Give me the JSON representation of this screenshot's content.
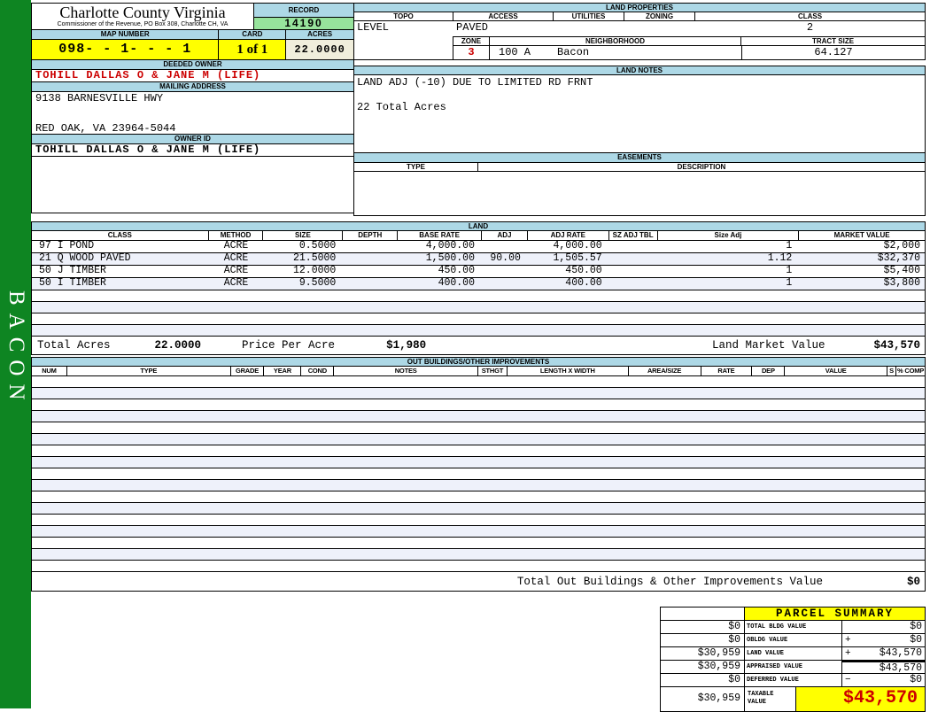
{
  "colors": {
    "band_green": "#0e8522",
    "bar_blue": "#ADD8E6",
    "highlight_yellow": "#ffff00",
    "record_green": "#97e39c",
    "acres_cream": "#f0eedc",
    "alert_red": "#cc0000",
    "alt_row": "#eef1fa"
  },
  "sidebar": {
    "band_text": "BACON"
  },
  "header": {
    "county_title": "Charlotte County Virginia",
    "county_subtitle": "Commissioner of the Revenue, PO Box 308, Charlotte CH, VA",
    "record_label": "RECORD",
    "record_value": "14190",
    "map_number_label": "MAP NUMBER",
    "map_number_value": "098- - 1- - - 1",
    "card_label": "CARD",
    "card_value": "1 of 1",
    "acres_label": "ACRES",
    "acres_value": "22.0000"
  },
  "owner": {
    "deeded_owner_label": "DEEDED OWNER",
    "deeded_owner": "TOHILL DALLAS O & JANE M (LIFE)",
    "mailing_address_label": "MAILING ADDRESS",
    "address_line1": "9138 BARNESVILLE HWY",
    "address_line2": "RED OAK, VA 23964-5044",
    "owner_id_label": "OWNER ID",
    "owner_id": "TOHILL DALLAS O & JANE M (LIFE)"
  },
  "land_properties": {
    "section_label": "LAND PROPERTIES",
    "topo_label": "TOPO",
    "topo": "LEVEL",
    "access_label": "ACCESS",
    "access": "PAVED",
    "utilities_label": "UTILITIES",
    "utilities": "",
    "zoning_label": "ZONING",
    "zoning": "",
    "class_label": "CLASS",
    "class": "2",
    "zone_label": "ZONE",
    "zone": "3",
    "neighborhood_label": "NEIGHBORHOOD",
    "neighborhood_code": "100 A",
    "neighborhood_name": "Bacon",
    "tract_size_label": "TRACT SIZE",
    "tract_size": "64.127"
  },
  "land_notes": {
    "section_label": "LAND NOTES",
    "line1": "LAND ADJ (-10) DUE TO LIMITED RD FRNT",
    "line2": "22 Total Acres"
  },
  "easements": {
    "section_label": "EASEMENTS",
    "type_label": "TYPE",
    "description_label": "DESCRIPTION"
  },
  "land_table": {
    "section_label": "LAND",
    "headers": [
      "CLASS",
      "METHOD",
      "SIZE",
      "DEPTH",
      "BASE RATE",
      "ADJ",
      "ADJ RATE",
      "SZ ADJ TBL",
      "Size Adj",
      "MARKET VALUE"
    ],
    "rows": [
      {
        "class": "97 I POND",
        "method": "ACRE",
        "size": "0.5000",
        "depth": "",
        "base_rate": "4,000.00",
        "adj": "",
        "adj_rate": "4,000.00",
        "sz_adj_tbl": "",
        "size_adj": "1",
        "market_value": "$2,000"
      },
      {
        "class": "21 Q WOOD PAVED",
        "method": "ACRE",
        "size": "21.5000",
        "depth": "",
        "base_rate": "1,500.00",
        "adj": "90.00",
        "adj_rate": "1,505.57",
        "sz_adj_tbl": "",
        "size_adj": "1.12",
        "market_value": "$32,370"
      },
      {
        "class": "50 J TIMBER",
        "method": "ACRE",
        "size": "12.0000",
        "depth": "",
        "base_rate": "450.00",
        "adj": "",
        "adj_rate": "450.00",
        "sz_adj_tbl": "",
        "size_adj": "1",
        "market_value": "$5,400"
      },
      {
        "class": "50 I TIMBER",
        "method": "ACRE",
        "size": "9.5000",
        "depth": "",
        "base_rate": "400.00",
        "adj": "",
        "adj_rate": "400.00",
        "sz_adj_tbl": "",
        "size_adj": "1",
        "market_value": "$3,800"
      }
    ],
    "total_acres_label": "Total Acres",
    "total_acres": "22.0000",
    "price_per_acre_label": "Price Per Acre",
    "price_per_acre": "$1,980",
    "land_market_value_label": "Land Market Value",
    "land_market_value": "$43,570"
  },
  "out_buildings": {
    "section_label": "OUT BUILDINGS/OTHER IMPROVEMENTS",
    "headers": [
      "NUM",
      "TYPE",
      "GRADE",
      "YEAR",
      "COND",
      "NOTES",
      "STHGT",
      "LENGTH X WIDTH",
      "AREA/SIZE",
      "RATE",
      "DEP",
      "VALUE",
      "S",
      "% COMP"
    ],
    "total_label": "Total Out Buildings & Other Improvements Value",
    "total_value": "$0"
  },
  "parcel_summary": {
    "title": "PARCEL SUMMARY",
    "rows": [
      {
        "prior": "$0",
        "label": "TOTAL BLDG VALUE",
        "op": "",
        "current": "$0"
      },
      {
        "prior": "$0",
        "label": "OBLDG VALUE",
        "op": "+",
        "current": "$0"
      },
      {
        "prior": "$30,959",
        "label": "LAND VALUE",
        "op": "+",
        "current": "$43,570"
      },
      {
        "prior": "$30,959",
        "label": "APPRAISED VALUE",
        "op": "",
        "current": "$43,570"
      },
      {
        "prior": "$0",
        "label": "DEFERRED VALUE",
        "op": "−",
        "current": "$0"
      }
    ],
    "taxable": {
      "prior": "$30,959",
      "label": "TAXABLE\nVALUE",
      "value": "$43,570"
    }
  }
}
